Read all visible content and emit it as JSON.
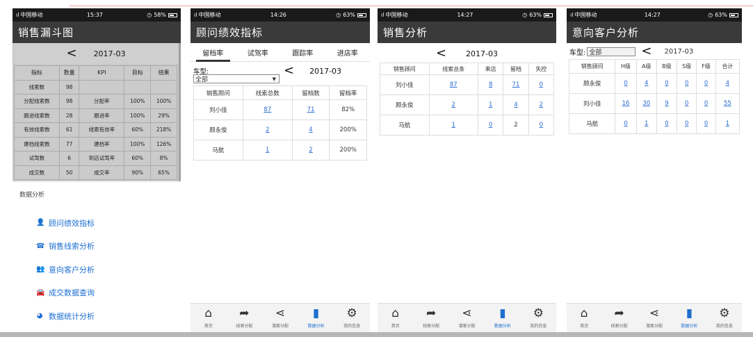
{
  "phone1": {
    "status": {
      "carrier": "中国移动",
      "time": "15:37",
      "battery": "58%"
    },
    "title": "销售漏斗图",
    "date_arrow": "<",
    "date": "2017-03",
    "table": {
      "headers": [
        "指标",
        "数量",
        "KPI",
        "目标",
        "结果"
      ],
      "rows": [
        [
          "线索数",
          "98",
          "",
          "",
          ""
        ],
        [
          "分配线索数",
          "98",
          "分配率",
          "100%",
          "100%"
        ],
        [
          "跟进线索数",
          "28",
          "跟进率",
          "100%",
          "29%"
        ],
        [
          "有效线索数",
          "61",
          "线索有效率",
          "60%",
          "218%"
        ],
        [
          "建档线索数",
          "77",
          "建档率",
          "100%",
          "126%"
        ],
        [
          "试驾数",
          "6",
          "到店试驾率",
          "60%",
          "8%"
        ],
        [
          "成交数",
          "50",
          "成交率",
          "90%",
          "65%"
        ]
      ]
    },
    "menu_heading": "数据分析",
    "menu": [
      {
        "icon": "person-icon",
        "glyph": "👤",
        "label": "顾问绩效指标"
      },
      {
        "icon": "phone-icon",
        "glyph": "☎",
        "label": "销售线索分析"
      },
      {
        "icon": "group-icon",
        "glyph": "👥",
        "label": "意向客户分析"
      },
      {
        "icon": "car-icon",
        "glyph": "🚘",
        "label": "成交数据查询"
      },
      {
        "icon": "pie-chart-icon",
        "glyph": "◕",
        "label": "数据统计分析"
      }
    ]
  },
  "phone2": {
    "status": {
      "carrier": "中国移动",
      "time": "14:26",
      "battery": "63%"
    },
    "title": "顾问绩效指标",
    "tabs": [
      "留档率",
      "试驾率",
      "跟踪率",
      "进店率"
    ],
    "car_label": "车型:",
    "car_value": "全部",
    "date_arrow": "<",
    "date": "2017-03",
    "headers": [
      "销售顾问",
      "线索总数",
      "留档数",
      "留档率"
    ],
    "rows": [
      [
        "刘小佳",
        "87",
        "71",
        "82%"
      ],
      [
        "顾永俊",
        "2",
        "4",
        "200%"
      ],
      [
        "马航",
        "1",
        "2",
        "200%"
      ]
    ]
  },
  "phone3": {
    "status": {
      "carrier": "中国移动",
      "time": "14:27",
      "battery": "63%"
    },
    "title": "销售分析",
    "date_arrow": "<",
    "date": "2017-03",
    "headers": [
      "销售顾问",
      "线索总条",
      "来店",
      "留档",
      "失控"
    ],
    "rows": [
      [
        "刘小佳",
        "87",
        "8",
        "71",
        "0"
      ],
      [
        "顾永俊",
        "2",
        "1",
        "4",
        "2"
      ],
      [
        "马航",
        "1",
        "0",
        "2",
        "0"
      ]
    ]
  },
  "phone4": {
    "status": {
      "carrier": "中国移动",
      "time": "14:27",
      "battery": "63%"
    },
    "title": "意向客户分析",
    "car_label": "车型:",
    "car_value": "全部",
    "date_arrow": "<",
    "date": "2017-03",
    "headers": [
      "销售顾问",
      "H级",
      "A级",
      "B级",
      "S级",
      "F级",
      "合计"
    ],
    "rows": [
      [
        "顾永俊",
        "0",
        "4",
        "0",
        "0",
        "0",
        "4"
      ],
      [
        "刘小佳",
        "16",
        "30",
        "9",
        "0",
        "0",
        "55"
      ],
      [
        "马航",
        "0",
        "1",
        "0",
        "0",
        "0",
        "1"
      ]
    ]
  },
  "bottom_nav": [
    {
      "icon": "home-icon",
      "glyph": "⌂",
      "label": "首页"
    },
    {
      "icon": "share-arrow-icon",
      "glyph": "➦",
      "label": "线索分配"
    },
    {
      "icon": "share-icon",
      "glyph": "⋖",
      "label": "潜客分配"
    },
    {
      "icon": "bar-chart-icon",
      "glyph": "▮",
      "label": "数据分析"
    },
    {
      "icon": "gear-icon",
      "glyph": "⚙",
      "label": "我的信息"
    }
  ]
}
